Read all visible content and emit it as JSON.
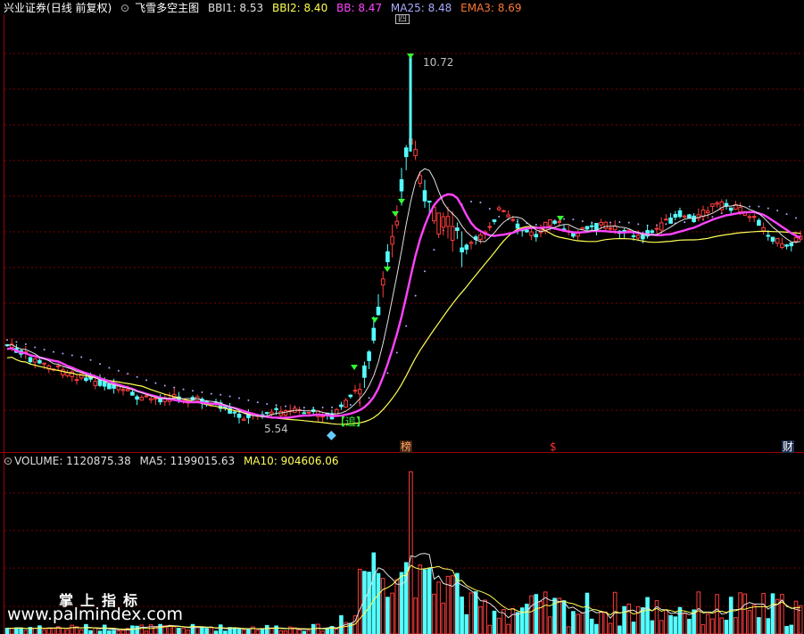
{
  "header": {
    "broker": "兴业证券",
    "period": "(日线 前复权)",
    "indicator_name": "飞雪多空主图",
    "indicators": [
      {
        "label": "BBI1: 8.53",
        "color": "#e0e0e0"
      },
      {
        "label": "BBI2: 8.40",
        "color": "#ffff55"
      },
      {
        "label": "BB: 8.47",
        "color": "#ff44ff"
      },
      {
        "label": "MA25: 8.48",
        "color": "#aaaaff"
      },
      {
        "label": "EMA3: 8.69",
        "color": "#ff7733"
      }
    ]
  },
  "volume_header": {
    "indicators": [
      {
        "label": "VOLUME: 1120875.38",
        "color": "#e0e0e0"
      },
      {
        "label": "MA5: 1199015.63",
        "color": "#e0e0e0"
      },
      {
        "label": "MA10: 904606.06",
        "color": "#ffff55"
      }
    ]
  },
  "annotations": {
    "high_label": "10.72",
    "low_label": "5.54",
    "chase_label": "【追】",
    "event_bang": "榜",
    "event_s": "$",
    "event_cai": "财"
  },
  "watermark": {
    "cn": "掌上指标",
    "url": "www.palmindex.com"
  },
  "colors": {
    "up": "#ff3c3c",
    "down": "#54ffff",
    "bbi1": "#e0e0e0",
    "bbi2": "#ffff55",
    "bb": "#ff44ff",
    "ma25": "#aaaaff",
    "grid": "#7a0000",
    "frame": "#a00000"
  },
  "chart_data": {
    "type": "candlestick",
    "ylim": [
      5.0,
      11.2
    ],
    "high": 10.72,
    "low": 5.54,
    "series": [
      {
        "name": "BBI1"
      },
      {
        "name": "BBI2"
      },
      {
        "name": "BB"
      },
      {
        "name": "MA25"
      },
      {
        "name": "EMA3"
      },
      {
        "name": "VOLUME"
      },
      {
        "name": "MA5"
      },
      {
        "name": "MA10"
      }
    ],
    "legend": "top-left",
    "grid": true
  }
}
